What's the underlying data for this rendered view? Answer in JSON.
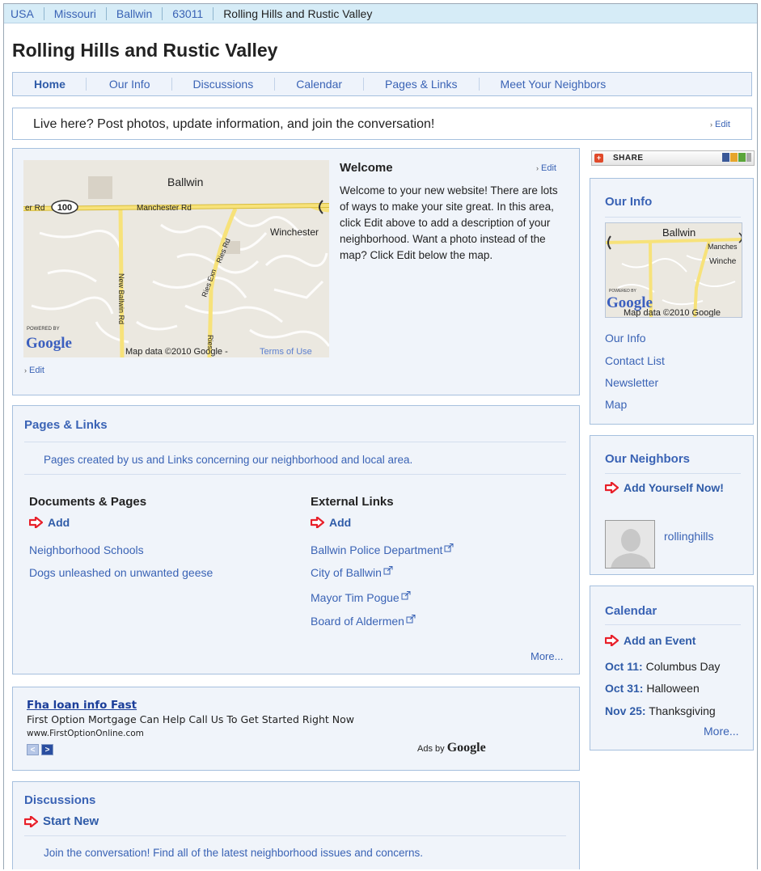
{
  "breadcrumb": [
    "USA",
    "Missouri",
    "Ballwin",
    "63011",
    "Rolling Hills and Rustic Valley"
  ],
  "site_title": "Rolling Hills and Rustic Valley",
  "nav": [
    "Home",
    "Our Info",
    "Discussions",
    "Calendar",
    "Pages & Links",
    "Meet Your Neighbors"
  ],
  "cta": {
    "text": "Live here? Post photos, update information, and join the conversation!",
    "edit": "Edit"
  },
  "welcome": {
    "title": "Welcome",
    "edit": "Edit",
    "body": "Welcome to your new website! There are lots of ways to make your site great. In this area, click Edit above to add a description of your neighborhood. Want a photo instead of the map? Click Edit below the map.",
    "map_edit": "Edit",
    "map": {
      "city": "Ballwin",
      "route": "100",
      "road_left": "er Rd",
      "road_main": "Manchester Rd",
      "place": "Winchester",
      "streets": [
        "Ries Rd",
        "Ries Exn",
        "New Ballwin Rd",
        "Ries"
      ],
      "powered_by": "POWERED BY",
      "logo": "Google",
      "copyright": "Map data ©2010 Google -",
      "terms": "Terms of Use"
    }
  },
  "pages_links": {
    "title": "Pages & Links",
    "description": "Pages created by us and Links concerning our neighborhood and local area.",
    "documents": {
      "title": "Documents & Pages",
      "add": "Add",
      "items": [
        "Neighborhood Schools",
        "Dogs unleashed on unwanted geese"
      ]
    },
    "external": {
      "title": "External Links",
      "add": "Add",
      "items": [
        "Ballwin Police Department",
        "City of Ballwin",
        "Mayor Tim Pogue",
        "Board of Aldermen"
      ]
    },
    "more": "More..."
  },
  "ad": {
    "title": "Fha loan info Fast",
    "body": "First Option Mortgage Can Help Call Us To Get Started Right Now",
    "url": "www.FirstOptionOnline.com",
    "ads_by": "Ads by",
    "ads_logo": "Google"
  },
  "discussions": {
    "title": "Discussions",
    "start_new": "Start New",
    "description": "Join the conversation! Find all of the latest neighborhood issues and concerns."
  },
  "share": {
    "label": "SHARE"
  },
  "our_info": {
    "title": "Our Info",
    "map": {
      "city": "Ballwin",
      "road": "Manches",
      "place": "Winche",
      "powered_by": "POWERED BY",
      "logo": "Google",
      "copyright": "Map data ©2010 Google"
    },
    "links": [
      "Our Info",
      "Contact List",
      "Newsletter",
      "Map"
    ]
  },
  "our_neighbors": {
    "title": "Our Neighbors",
    "add": "Add Yourself Now!",
    "member": "rollinghills"
  },
  "calendar": {
    "title": "Calendar",
    "add": "Add an Event",
    "events": [
      {
        "date": "Oct 11:",
        "name": "Columbus Day"
      },
      {
        "date": "Oct 31:",
        "name": "Halloween"
      },
      {
        "date": "Nov 25:",
        "name": "Thanksgiving"
      }
    ],
    "more": "More..."
  },
  "colors": {
    "link": "#3a63b5",
    "box_bg": "#f0f4fa",
    "border": "#a6c0de",
    "crumb_bg": "#d6ecf7",
    "arrow_red": "#e8202a"
  }
}
